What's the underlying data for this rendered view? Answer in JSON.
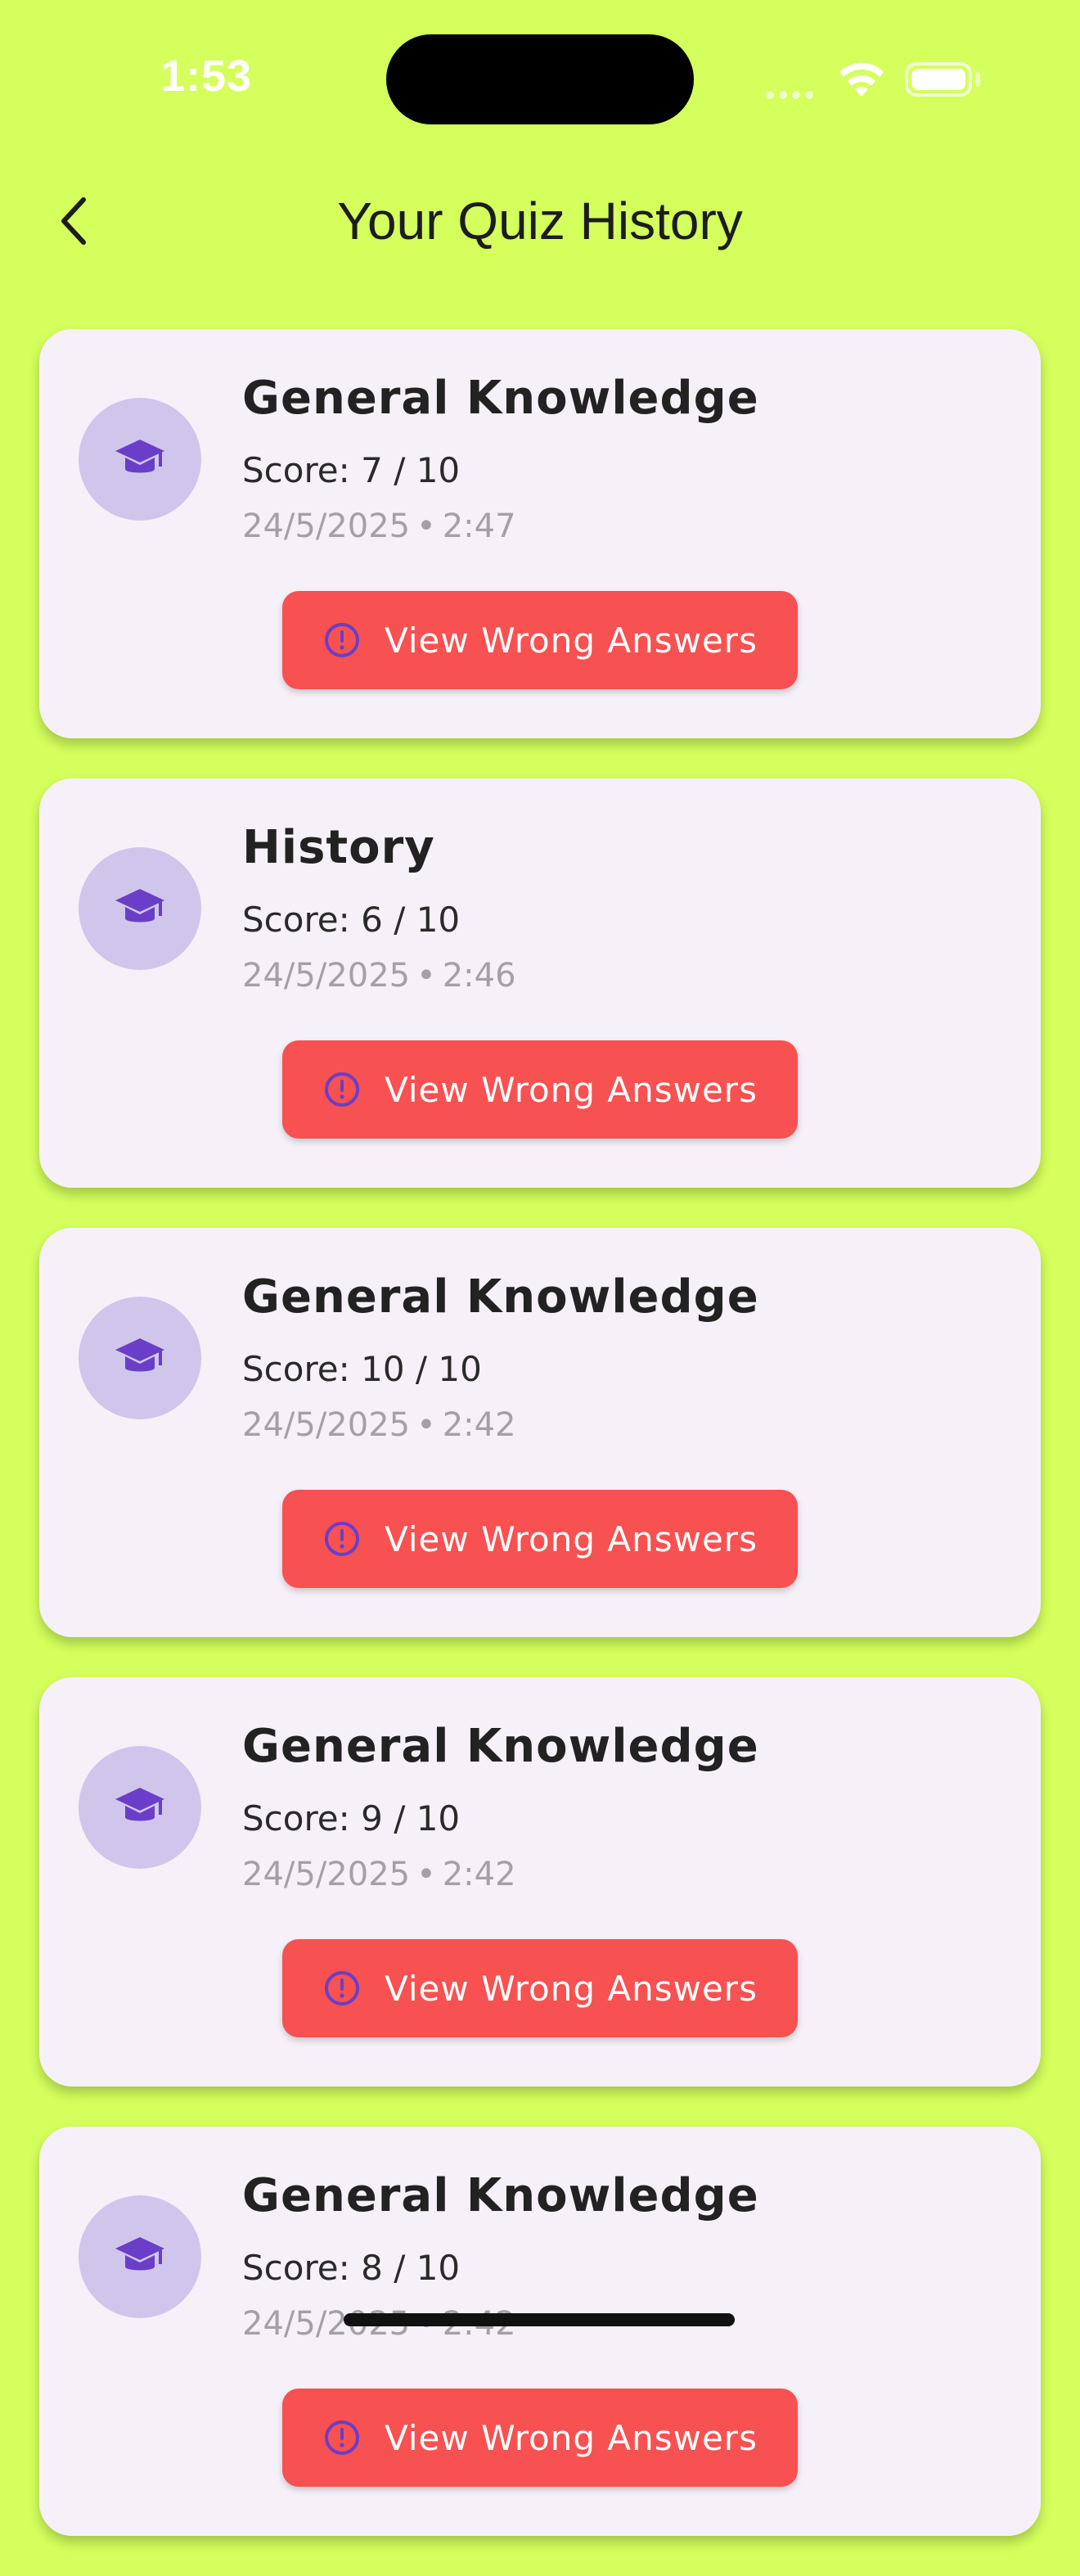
{
  "status_bar": {
    "time": "1:53"
  },
  "header": {
    "title": "Your Quiz History",
    "back_icon": "chevron-left-icon"
  },
  "colors": {
    "background": "#d4ff5c",
    "card": "#f6f1f9",
    "avatar_bg": "#d0c6eb",
    "icon_purple": "#6a3ec8",
    "button_red": "#f75151"
  },
  "history": [
    {
      "title": "General Knowledge",
      "score": "Score: 7 / 10",
      "date": "24/5/2025",
      "time": "2:47",
      "button": "View Wrong Answers"
    },
    {
      "title": "History",
      "score": "Score: 6 / 10",
      "date": "24/5/2025",
      "time": "2:46",
      "button": "View Wrong Answers"
    },
    {
      "title": "General Knowledge",
      "score": "Score: 10 / 10",
      "date": "24/5/2025",
      "time": "2:42",
      "button": "View Wrong Answers"
    },
    {
      "title": "General Knowledge",
      "score": "Score: 9 / 10",
      "date": "24/5/2025",
      "time": "2:42",
      "button": "View Wrong Answers"
    },
    {
      "title": "General Knowledge",
      "score": "Score: 8 / 10",
      "date": "24/5/2025",
      "time": "2:42",
      "button": "View Wrong Answers"
    }
  ],
  "separator": "•"
}
